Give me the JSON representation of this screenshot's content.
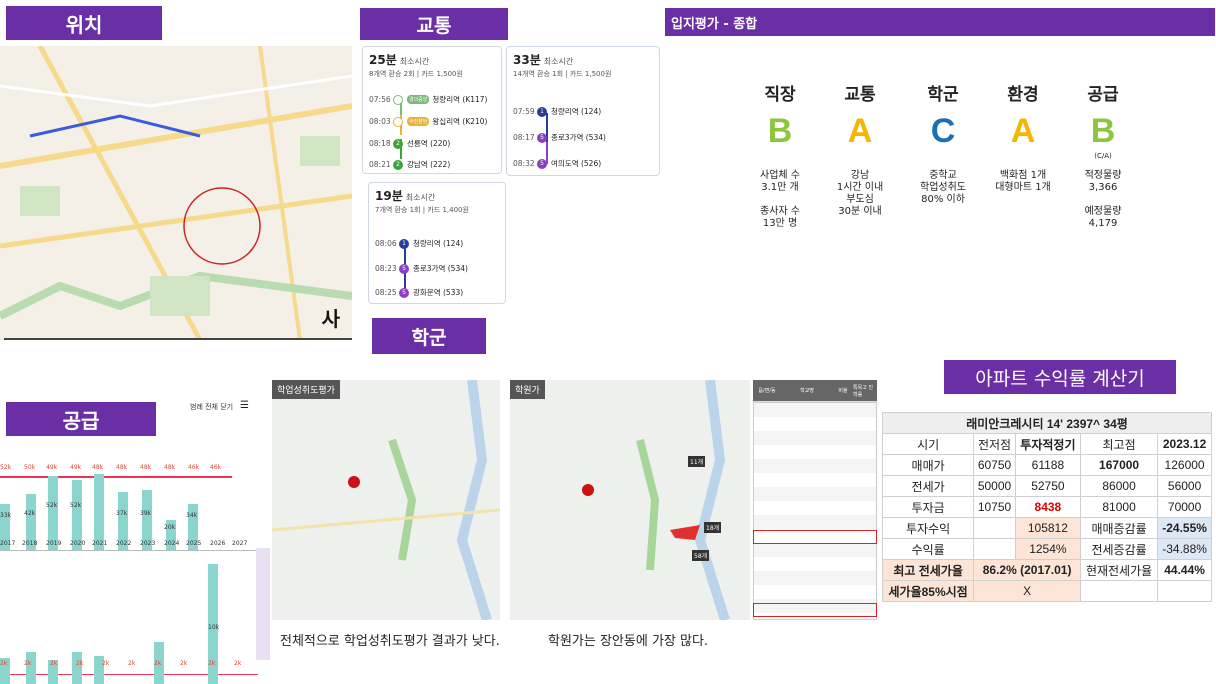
{
  "headers": {
    "location": "위치",
    "transport": "교통",
    "eval": "입지평가 - 종합",
    "school": "학군",
    "supply": "공급",
    "calculator": "아파트 수익률 계산기"
  },
  "map_corner": "사",
  "routes": [
    {
      "time": "25분",
      "label": "최소시간",
      "sub": "8개역 환승 2회 | 카드 1,500원",
      "stops": [
        {
          "t": "07:56",
          "n": "청량리역 (K117)",
          "badge": "경의중앙"
        },
        {
          "t": "08:03",
          "n": "왕십리역 (K210)",
          "badge": "수인분당"
        },
        {
          "t": "08:18",
          "n": "선릉역 (220)",
          "badge": "2"
        },
        {
          "t": "08:21",
          "n": "강남역 (222)",
          "badge": "2"
        }
      ]
    },
    {
      "time": "33분",
      "label": "최소시간",
      "sub": "14개역 환승 1회 | 카드 1,500원",
      "stops": [
        {
          "t": "07:59",
          "n": "청량리역 (124)",
          "badge": "1"
        },
        {
          "t": "08:17",
          "n": "종로3가역 (534)",
          "badge": "5"
        },
        {
          "t": "08:32",
          "n": "여의도역 (526)",
          "badge": "5"
        }
      ]
    },
    {
      "time": "19분",
      "label": "최소시간",
      "sub": "7개역 환승 1회 | 카드 1,400원",
      "stops": [
        {
          "t": "08:06",
          "n": "청량리역 (124)",
          "badge": "1"
        },
        {
          "t": "08:23",
          "n": "종로3가역 (534)",
          "badge": "5"
        },
        {
          "t": "08:25",
          "n": "광화문역 (533)",
          "badge": "5"
        }
      ]
    }
  ],
  "evaluation": [
    {
      "title": "직장",
      "grade": "B",
      "color": "#8cc63f",
      "sub": "",
      "desc": "사업체 수\n3.1만 개\n\n종사자 수\n13만 명"
    },
    {
      "title": "교통",
      "grade": "A",
      "color": "#f7b500",
      "sub": "",
      "desc": "강남\n1시간 이내\n부도심\n30분 이내"
    },
    {
      "title": "학군",
      "grade": "C",
      "color": "#1a6fb5",
      "sub": "",
      "desc": "중학교\n학업성취도\n80% 이하"
    },
    {
      "title": "환경",
      "grade": "A",
      "color": "#f7b500",
      "sub": "",
      "desc": "백화점 1개\n대형마트 1개"
    },
    {
      "title": "공급",
      "grade": "B",
      "color": "#8cc63f",
      "sub": "(C/A)",
      "desc": "적정물량\n3,366\n\n예정물량\n4,179"
    }
  ],
  "school": {
    "map1_title": "학업성취도평가",
    "map2_title": "학원가",
    "caption1": "전체적으로 학업성취도평가 결과가 낮다.",
    "caption2": "학원가는 장안동에 가장 많다.",
    "map2_labels": [
      "11개",
      "18개",
      "58개"
    ],
    "table_headers": [
      "읍/면/동",
      "학교명",
      "비율",
      "특목고 진학률"
    ]
  },
  "supply": {
    "toggle": "범례 전체 닫기",
    "years": [
      "2017",
      "2018",
      "2019",
      "2020",
      "2021",
      "2022",
      "2023",
      "2024",
      "2025",
      "2026",
      "2027"
    ],
    "need": [
      "52k",
      "50k",
      "49k",
      "49k",
      "48k",
      "48k",
      "48k",
      "48k",
      "46k",
      "46k"
    ],
    "bars": [
      "33k",
      "42k",
      "52k",
      "52k",
      "37k",
      "39k",
      "20k",
      "34k"
    ],
    "lower": [
      "2k",
      "2k",
      "2k",
      "2k",
      "2k",
      "2k",
      "2k",
      "2k",
      "2k",
      "2k"
    ],
    "tall": "10k"
  },
  "calc": {
    "title": "래미안크레시티 14' 2397^ 34평",
    "head": [
      "시기",
      "전저점",
      "투자적정기",
      "최고점",
      "2023.12"
    ],
    "rows": [
      [
        "매매가",
        "60750",
        "61188",
        "167000",
        "126000"
      ],
      [
        "전세가",
        "50000",
        "52750",
        "86000",
        "56000"
      ],
      [
        "투자금",
        "10750",
        "8438",
        "81000",
        "70000"
      ],
      [
        "투자수익",
        "",
        "105812",
        "매매증감률",
        "-24.55%"
      ],
      [
        "수익률",
        "",
        "1254%",
        "전세증감률",
        "-34.88%"
      ]
    ],
    "max_label": "최고 전세가율",
    "max_value": "86.2% (2017.01)",
    "cur_label": "현재전세가율",
    "cur_value": "44.44%",
    "p85_label": "세가율85%시점",
    "p85_value": "X"
  }
}
